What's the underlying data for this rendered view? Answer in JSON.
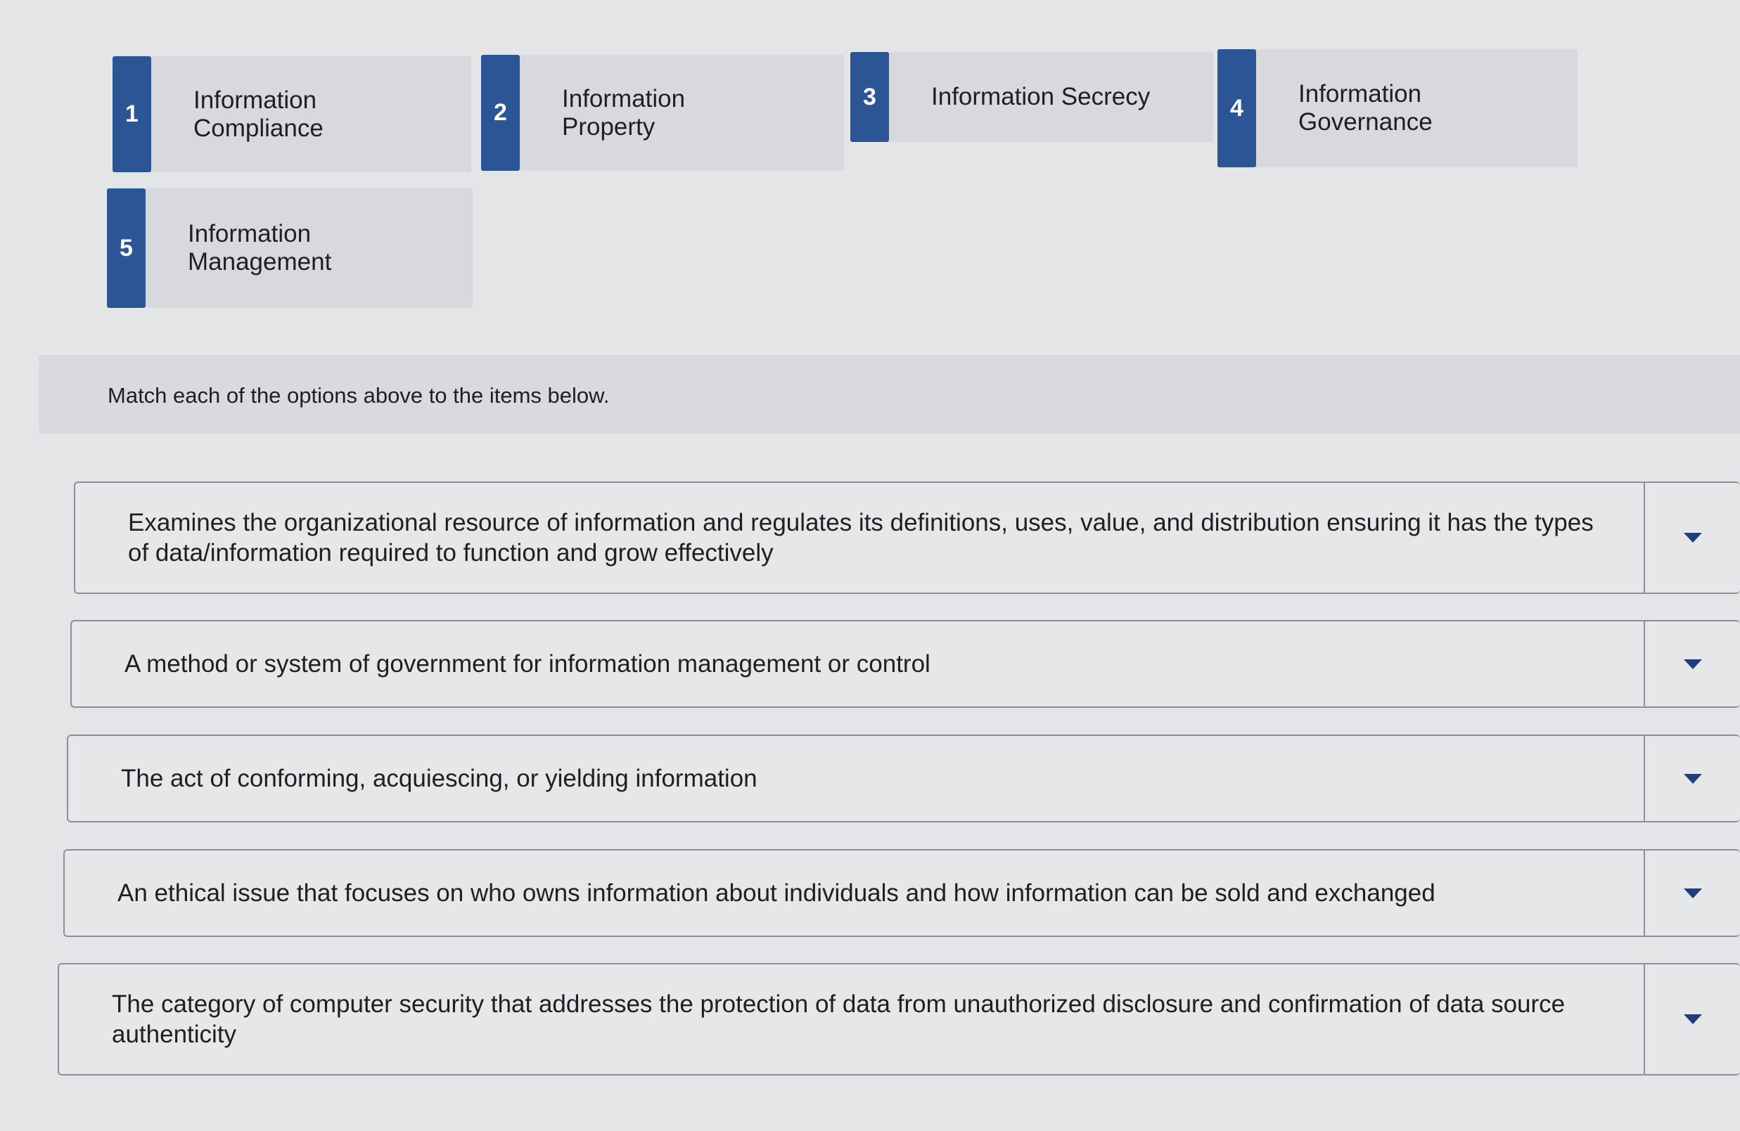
{
  "options": [
    {
      "number": "1",
      "label": "Information\nCompliance"
    },
    {
      "number": "2",
      "label": "Information\nProperty"
    },
    {
      "number": "3",
      "label": "Information Secrecy"
    },
    {
      "number": "4",
      "label": "Information\nGovernance"
    },
    {
      "number": "5",
      "label": "Information\nManagement"
    }
  ],
  "instructions": "Match each of the options above to the items below.",
  "items": [
    {
      "text": "Examines the organizational resource of information and regulates its definitions, uses, value, and distribution ensuring it has the types of data/information required to function and grow effectively",
      "selected": ""
    },
    {
      "text": "A method or system of government for information management or control",
      "selected": ""
    },
    {
      "text": "The act of conforming, acquiescing, or yielding information",
      "selected": ""
    },
    {
      "text": "An ethical issue that focuses on who owns information about individuals and how information can be sold and exchanged",
      "selected": ""
    },
    {
      "text": "The category of computer security that addresses the protection of data from unauthorized disclosure and confirmation of data source authenticity",
      "selected": ""
    }
  ]
}
